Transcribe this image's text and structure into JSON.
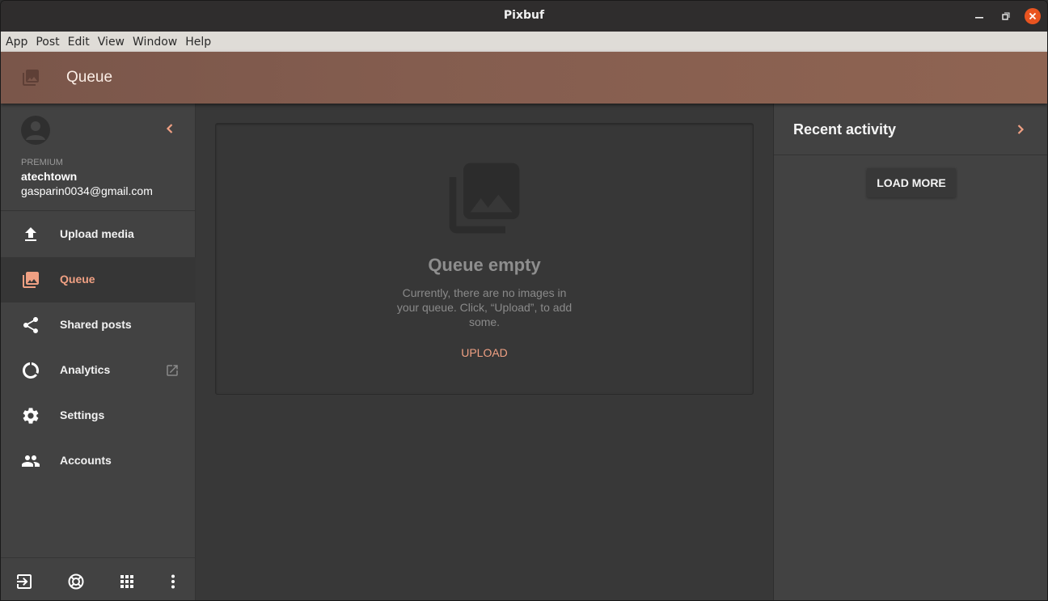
{
  "window": {
    "title": "Pixbuf",
    "controls": {
      "minimize": "minimize-icon",
      "restore": "restore-icon",
      "close": "close-icon"
    }
  },
  "menubar": {
    "items": [
      "App",
      "Post",
      "Edit",
      "View",
      "Window",
      "Help"
    ]
  },
  "appbar": {
    "icon": "photo-library-icon",
    "title": "Queue"
  },
  "profile": {
    "tier": "PREMIUM",
    "username": "atechtown",
    "email": "gasparin0034@gmail.com"
  },
  "sidebar": {
    "items": [
      {
        "label": "Upload media",
        "icon": "upload-icon",
        "active": false
      },
      {
        "label": "Queue",
        "icon": "photo-library-icon",
        "active": true
      },
      {
        "label": "Shared posts",
        "icon": "share-icon",
        "active": false
      },
      {
        "label": "Analytics",
        "icon": "analytics-ring-icon",
        "active": false,
        "external": true
      },
      {
        "label": "Settings",
        "icon": "gear-icon",
        "active": false
      },
      {
        "label": "Accounts",
        "icon": "people-icon",
        "active": false
      }
    ],
    "footer": [
      "sign-in-icon",
      "help-lifebuoy-icon",
      "apps-grid-icon",
      "more-vert-icon"
    ]
  },
  "main": {
    "empty_title": "Queue empty",
    "empty_description": "Currently, there are no images in your queue. Click, “Upload”, to add some.",
    "upload_label": "UPLOAD"
  },
  "recent": {
    "title": "Recent activity",
    "load_more_label": "LOAD MORE"
  },
  "colors": {
    "accent": "#f0a083",
    "appbar": "#845d4f",
    "close_button": "#e95420"
  }
}
